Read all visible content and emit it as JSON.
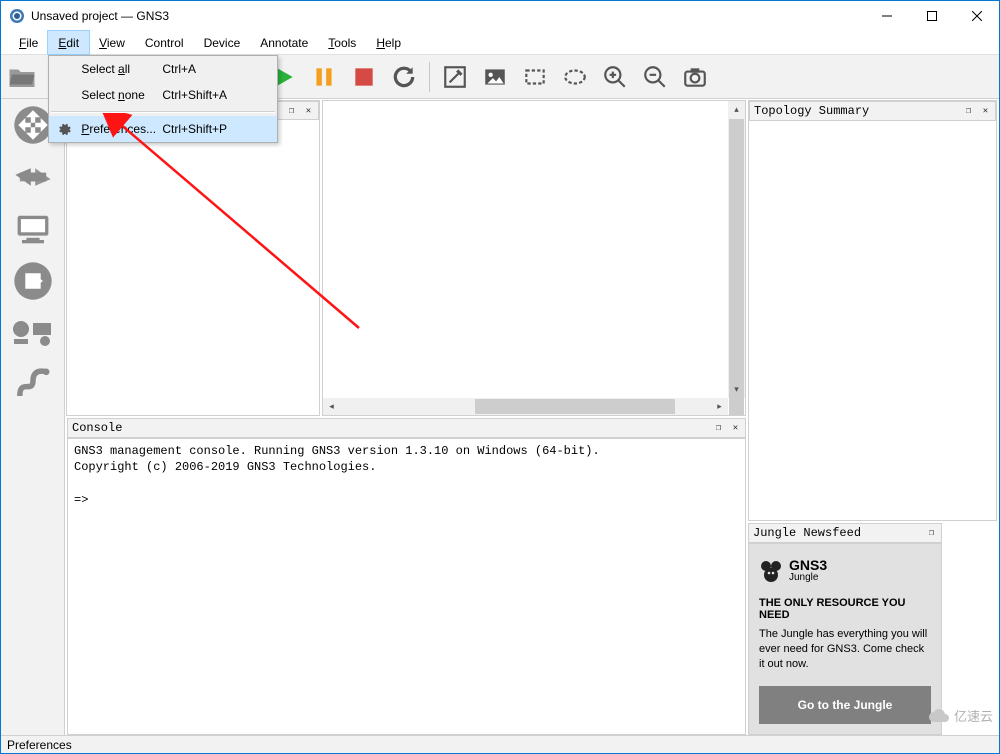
{
  "window": {
    "title": "Unsaved project — GNS3"
  },
  "menubar": [
    "File",
    "Edit",
    "View",
    "Control",
    "Device",
    "Annotate",
    "Tools",
    "Help"
  ],
  "edit_menu": {
    "items": [
      {
        "label": "Select all",
        "u_before": "Select ",
        "u": "a",
        "u_after": "ll",
        "shortcut": "Ctrl+A",
        "icon": null,
        "hl": false
      },
      {
        "label": "Select none",
        "u_before": "Select ",
        "u": "n",
        "u_after": "one",
        "shortcut": "Ctrl+Shift+A",
        "icon": null,
        "hl": false
      }
    ],
    "pref": {
      "label": "Preferences...",
      "u_before": "",
      "u": "P",
      "u_after": "references...",
      "shortcut": "Ctrl+Shift+P",
      "icon": "gear",
      "hl": true
    }
  },
  "panels": {
    "list_header": "",
    "topology": "Topology Summary",
    "console": "Console",
    "jungle": "Jungle Newsfeed"
  },
  "console": {
    "line1": "GNS3 management console. Running GNS3 version 1.3.10 on Windows (64-bit).",
    "line2": "Copyright (c) 2006-2019 GNS3 Technologies.",
    "prompt": "=>"
  },
  "jungle": {
    "brand": "GNS3",
    "brand_sub": "Jungle",
    "headline": "THE ONLY RESOURCE YOU NEED",
    "body": "The Jungle has everything you will ever need for GNS3. Come check it out now.",
    "cta": "Go to the Jungle"
  },
  "status": "Preferences",
  "watermark": "亿速云"
}
